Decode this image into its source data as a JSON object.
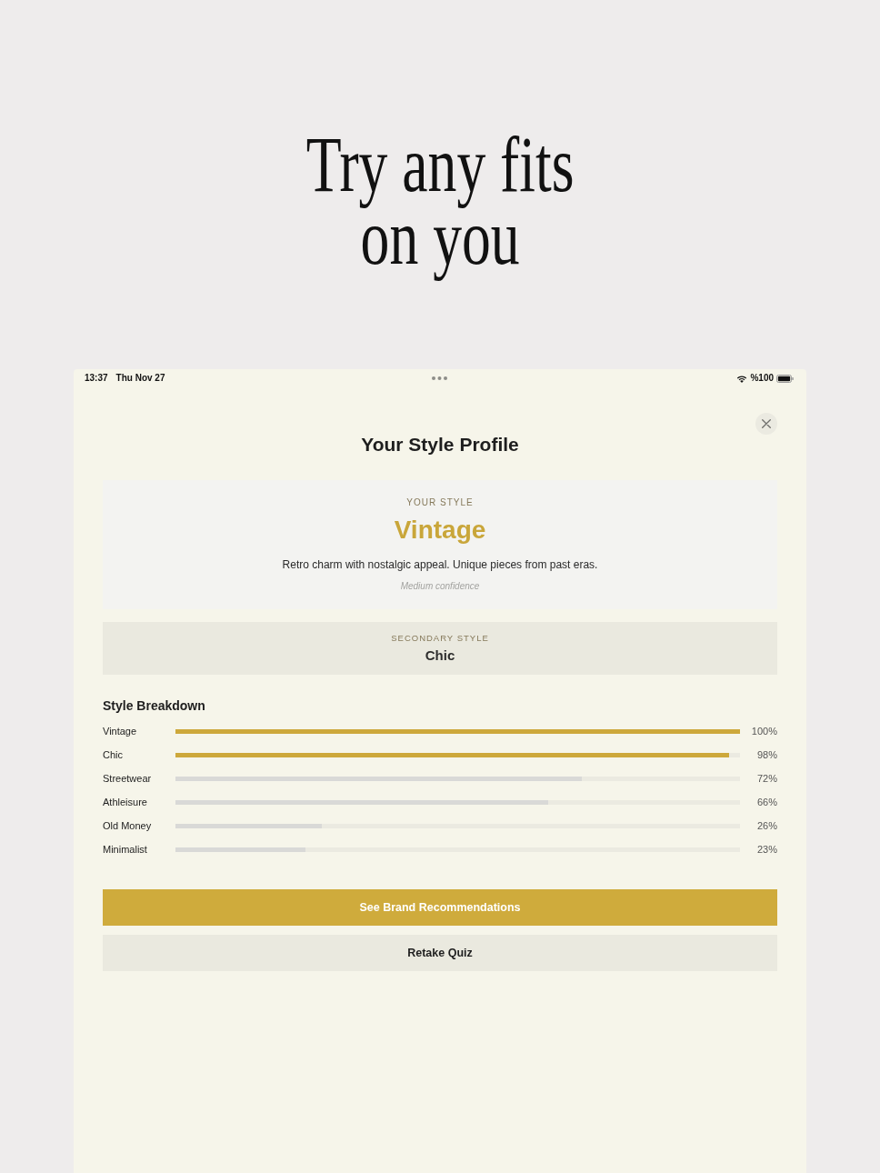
{
  "headline": {
    "lines": [
      "Try any fits",
      "on you"
    ]
  },
  "status_bar": {
    "time": "13:37",
    "date": "Thu Nov 27",
    "battery": "%100"
  },
  "sheet": {
    "title": "Your Style Profile"
  },
  "primary_style": {
    "caption": "YOUR STYLE",
    "name": "Vintage",
    "description": "Retro charm with nostalgic appeal. Unique pieces from past eras.",
    "confidence": "Medium confidence"
  },
  "secondary_style": {
    "caption": "SECONDARY STYLE",
    "name": "Chic"
  },
  "breakdown": {
    "title": "Style Breakdown",
    "rows": [
      {
        "label": "Vintage",
        "level": 1,
        "reading": "100%",
        "highlighted": true
      },
      {
        "label": "Chic",
        "level": 0.98,
        "reading": "98%",
        "highlighted": true
      },
      {
        "label": "Streetwear",
        "level": 0.72,
        "reading": "72%",
        "highlighted": false
      },
      {
        "label": "Athleisure",
        "level": 0.66,
        "reading": "66%",
        "highlighted": false
      },
      {
        "label": "Old Money",
        "level": 0.26,
        "reading": "26%",
        "highlighted": false
      },
      {
        "label": "Minimalist",
        "level": 0.23,
        "reading": "23%",
        "highlighted": false
      }
    ]
  },
  "buttons": [
    {
      "label": "See Brand Recommendations",
      "kind": "primary"
    },
    {
      "label": "Retake Quiz",
      "kind": "secondary"
    }
  ]
}
